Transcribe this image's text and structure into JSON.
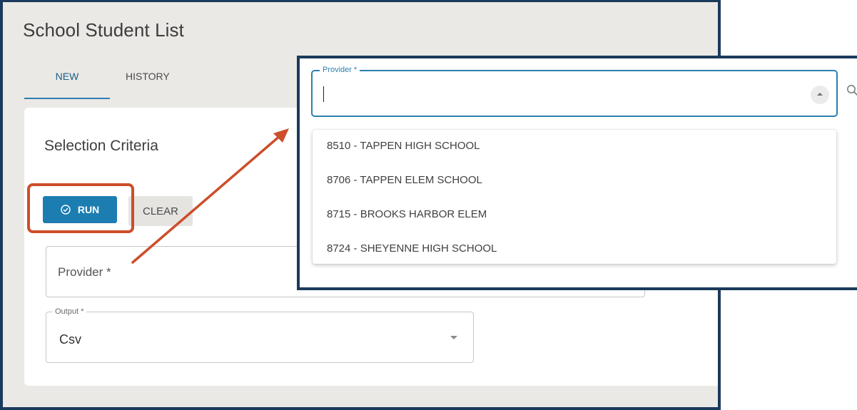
{
  "page": {
    "title": "School Student List"
  },
  "tabs": [
    {
      "label": "NEW",
      "active": true
    },
    {
      "label": "HISTORY",
      "active": false
    }
  ],
  "criteria": {
    "title": "Selection Criteria",
    "run_label": "RUN",
    "clear_label": "CLEAR",
    "provider_label": "Provider *",
    "output_label": "Output *",
    "output_value": "Csv"
  },
  "callout": {
    "field_label": "Provider *",
    "field_value": "",
    "options": [
      "8510 - TAPPEN HIGH SCHOOL",
      "8706 - TAPPEN ELEM SCHOOL",
      "8715 - BROOKS HARBOR ELEM",
      "8724 - SHEYENNE HIGH SCHOOL"
    ]
  },
  "icons": {
    "run": "check-circle-icon",
    "output_caret": "chevron-down-icon",
    "provider_toggle": "chevron-up-icon",
    "search": "search-icon"
  },
  "colors": {
    "primary": "#1c7db1",
    "frame": "#1b3a5c",
    "annotation": "#cc4e2a",
    "focus": "#2c7fb0"
  }
}
